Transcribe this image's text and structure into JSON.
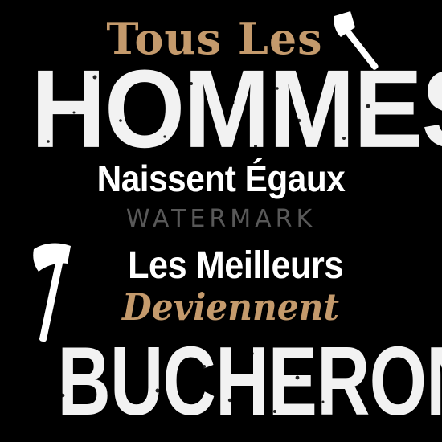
{
  "design": {
    "line1": "Tous Les",
    "line2": "HOMMES",
    "line3": "Naissent Égaux",
    "line4": "Les Meilleurs",
    "line5": "Deviennent",
    "line6": "BUCHERONS",
    "watermark": "WATERMARK"
  },
  "colors": {
    "background": "#000000",
    "accent": "#c49a6c",
    "text": "#f2f2f2"
  },
  "icons": [
    "axe-icon",
    "axe-icon"
  ]
}
